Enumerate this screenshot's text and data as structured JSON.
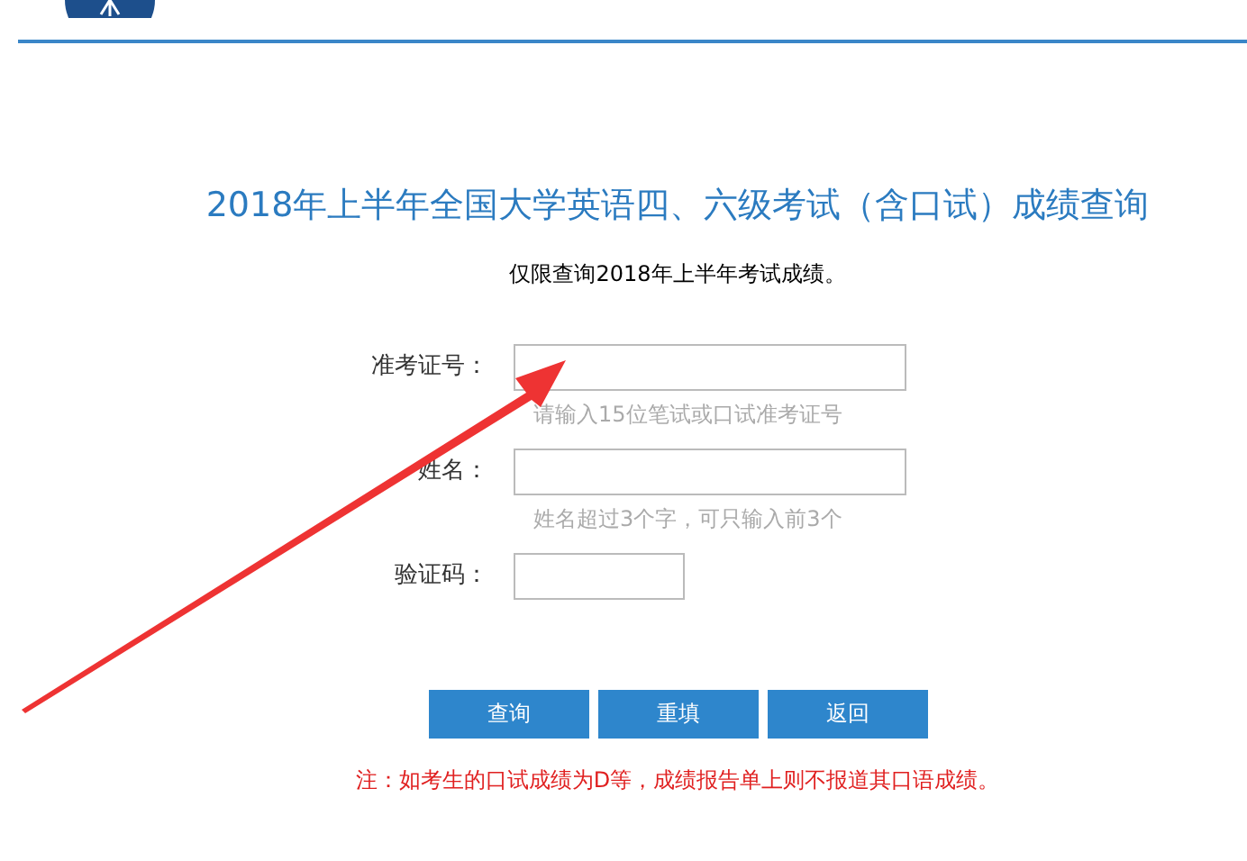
{
  "title": "2018年上半年全国大学英语四、六级考试（含口试）成绩查询",
  "subtitle": "仅限查询2018年上半年考试成绩。",
  "fields": [
    {
      "label": "准考证号：",
      "hint": "请输入15位笔试或口试准考证号",
      "kind": "wide"
    },
    {
      "label": "姓名：",
      "hint": "姓名超过3个字，可只输入前3个",
      "kind": "wide"
    },
    {
      "label": "验证码：",
      "kind": "short"
    }
  ],
  "buttons": [
    "查询",
    "重填",
    "返回"
  ],
  "note": "注：如考生的口试成绩为D等，成绩报告单上则不报道其口语成绩。"
}
